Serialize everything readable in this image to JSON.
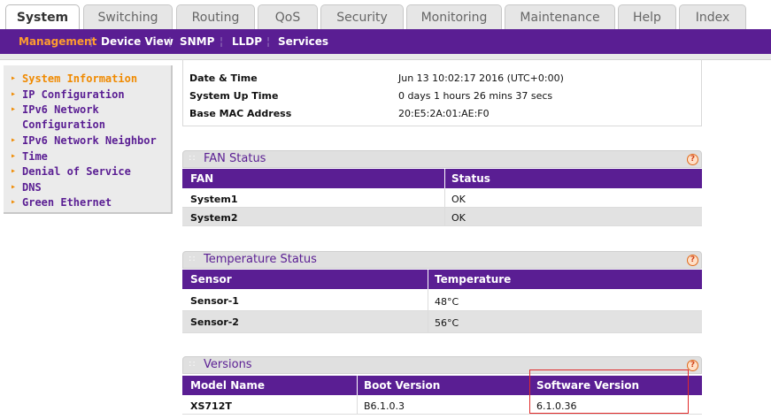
{
  "tabs": [
    "System",
    "Switching",
    "Routing",
    "QoS",
    "Security",
    "Monitoring",
    "Maintenance",
    "Help",
    "Index"
  ],
  "subnav": [
    "Management",
    "Device View",
    "SNMP",
    "LLDP",
    "Services"
  ],
  "sidebar": {
    "items": [
      {
        "label": "System Information",
        "active": true
      },
      {
        "label": "IP Configuration"
      },
      {
        "label": "IPv6 Network Configuration"
      },
      {
        "label": "IPv6 Network Neighbor"
      },
      {
        "label": "Time"
      },
      {
        "label": "Denial of Service"
      },
      {
        "label": "DNS"
      },
      {
        "label": "Green Ethernet"
      }
    ]
  },
  "system_info": {
    "rows": [
      {
        "label": "Date & Time",
        "value": "Jun 13 10:02:17 2016 (UTC+0:00)"
      },
      {
        "label": "System Up Time",
        "value": "0 days 1 hours 26 mins 37 secs"
      },
      {
        "label": "Base MAC Address",
        "value": "20:E5:2A:01:AE:F0"
      }
    ]
  },
  "fan": {
    "title": "FAN Status",
    "headers": [
      "FAN",
      "Status"
    ],
    "rows": [
      [
        "System1",
        "OK"
      ],
      [
        "System2",
        "OK"
      ]
    ]
  },
  "temperature": {
    "title": "Temperature Status",
    "headers": [
      "Sensor",
      "Temperature"
    ],
    "rows": [
      [
        "Sensor-1",
        "48°C"
      ],
      [
        "Sensor-2",
        "56°C"
      ]
    ]
  },
  "versions": {
    "title": "Versions",
    "headers": [
      "Model Name",
      "Boot Version",
      "Software Version"
    ],
    "rows": [
      [
        "XS712T",
        "B6.1.0.3",
        "6.1.0.36"
      ]
    ]
  },
  "help_glyph": "?",
  "icons": {
    "sidebar_bullet": "arrow-right-icon",
    "help": "help-icon"
  },
  "colors": {
    "brand_purple": "#5a1e93",
    "accent_orange": "#f08a00",
    "highlight_red": "#e02a2a"
  }
}
